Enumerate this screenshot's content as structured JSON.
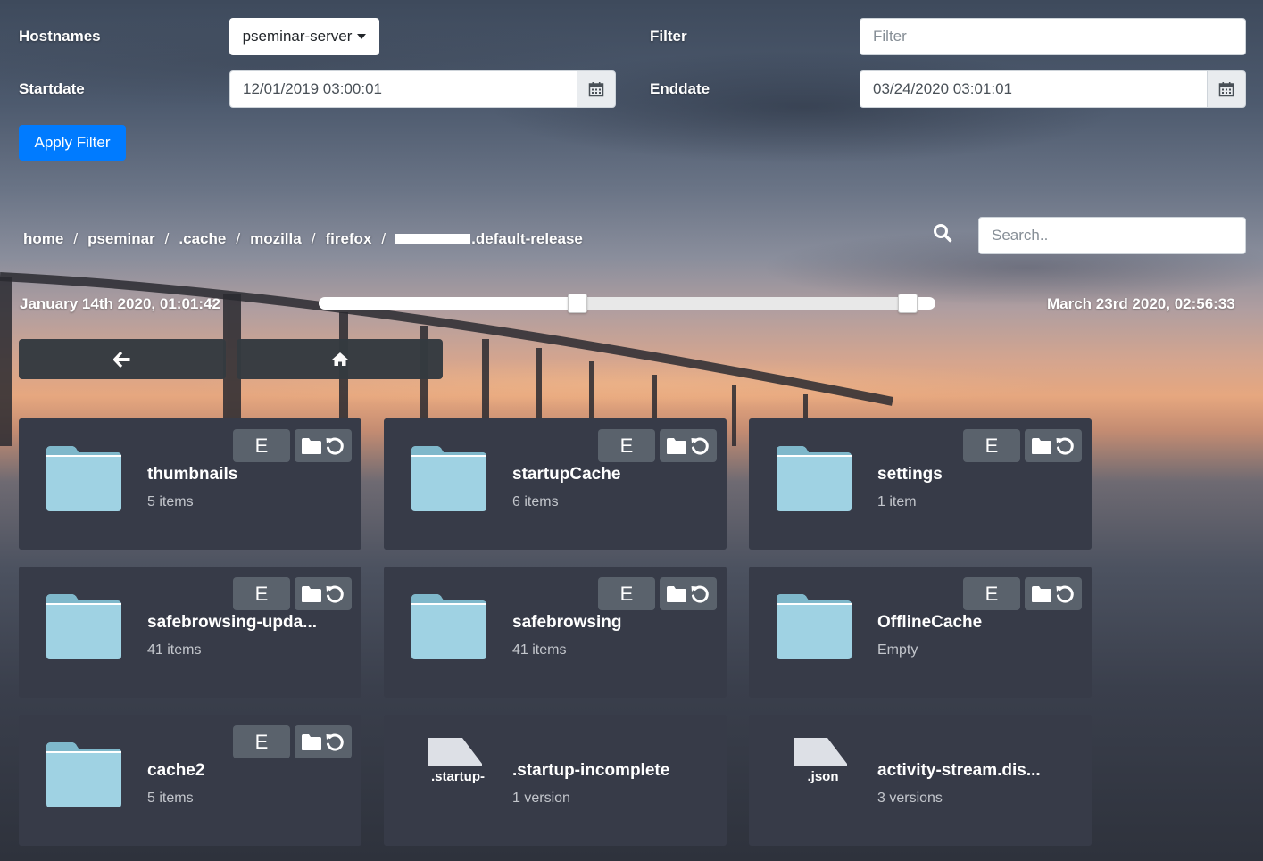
{
  "filters": {
    "hostnames_label": "Hostnames",
    "hostname_value": "pseminar-server",
    "filter_label": "Filter",
    "filter_placeholder": "Filter",
    "startdate_label": "Startdate",
    "startdate_value": "12/01/2019 03:00:01",
    "enddate_label": "Enddate",
    "enddate_value": "03/24/2020 03:01:01",
    "apply_label": "Apply Filter"
  },
  "breadcrumb": {
    "items": [
      "home",
      "pseminar",
      ".cache",
      "mozilla",
      "firefox"
    ],
    "separator": "/",
    "last_item": ".default-release"
  },
  "search": {
    "placeholder": "Search.."
  },
  "timeline": {
    "start_label": "January 14th 2020, 01:01:42",
    "end_label": "March 23rd 2020, 02:56:33",
    "range_low": 0.42,
    "range_high": 0.955
  },
  "entries": [
    {
      "type": "folder",
      "name": "thumbnails",
      "meta": "5 items"
    },
    {
      "type": "folder",
      "name": "startupCache",
      "meta": "6 items"
    },
    {
      "type": "folder",
      "name": "settings",
      "meta": "1 item"
    },
    {
      "type": "folder",
      "name": "safebrowsing-upda...",
      "meta": "41 items"
    },
    {
      "type": "folder",
      "name": "safebrowsing",
      "meta": "41 items"
    },
    {
      "type": "folder",
      "name": "OfflineCache",
      "meta": "Empty"
    },
    {
      "type": "folder",
      "name": "cache2",
      "meta": "5 items"
    },
    {
      "type": "file",
      "ext": ".startup-",
      "name": ".startup-incomplete",
      "meta": "1 version"
    },
    {
      "type": "file",
      "ext": ".json",
      "name": "activity-stream.dis...",
      "meta": "3 versions"
    }
  ],
  "card_buttons": {
    "edit_label": "E"
  },
  "icons": {
    "calendar": "calendar-icon",
    "search": "search-icon",
    "back": "arrow-left-icon",
    "home": "home-icon",
    "folder": "folder-icon",
    "file": "file-icon",
    "history": "history-icon"
  },
  "colors": {
    "primary": "#007bff",
    "card": "#373b48",
    "nav_button": "#343a40",
    "folder": "#9fd2e3"
  }
}
